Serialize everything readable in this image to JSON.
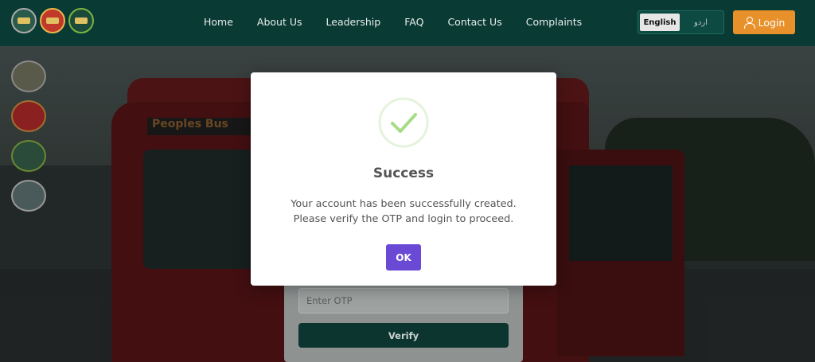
{
  "nav": {
    "items": [
      "Home",
      "About Us",
      "Leadership",
      "FAQ",
      "Contact Us",
      "Complaints"
    ]
  },
  "language": {
    "english": "English",
    "urdu": "اردو"
  },
  "login_label": "Login",
  "bus_sign": "Peoples Bus",
  "form": {
    "otp_placeholder": "Enter OTP",
    "verify_label": "Verify"
  },
  "modal": {
    "title": "Success",
    "line1": "Your account has been successfully created.",
    "line2": "Please verify the OTP and login to proceed.",
    "ok_label": "OK"
  },
  "colors": {
    "header_bg": "#0a3a34",
    "login_bg": "#e8902a",
    "ok_bg": "#6a4ad4",
    "success_green": "#a5dc86"
  }
}
